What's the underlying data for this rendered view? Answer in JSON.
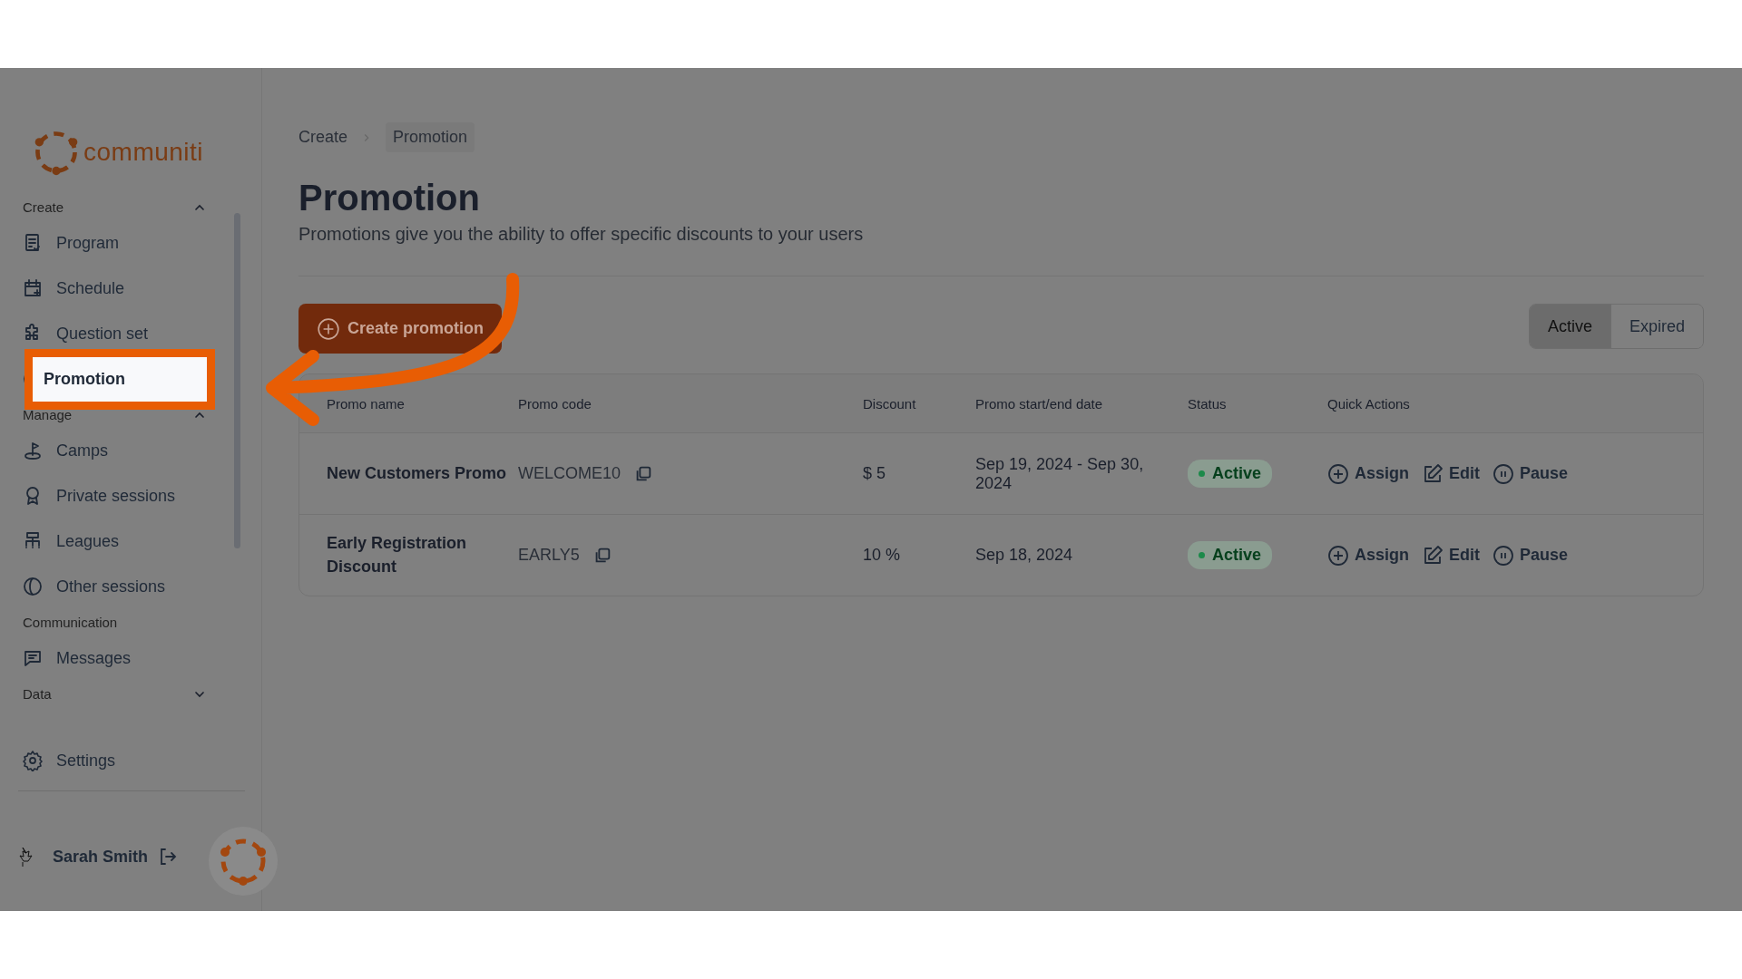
{
  "logo": {
    "text": "communiti"
  },
  "sidebar": {
    "sections": [
      {
        "title": "Create",
        "expanded": true,
        "items": [
          {
            "label": "Program",
            "selected": false
          },
          {
            "label": "Schedule",
            "selected": false
          },
          {
            "label": "Question set",
            "selected": false
          },
          {
            "label": "Promotion",
            "selected": true
          }
        ]
      },
      {
        "title": "Manage",
        "expanded": true,
        "items": [
          {
            "label": "Camps",
            "selected": false
          },
          {
            "label": "Private sessions",
            "selected": false
          },
          {
            "label": "Leagues",
            "selected": false
          },
          {
            "label": "Other sessions",
            "selected": false
          }
        ]
      },
      {
        "title": "Communication",
        "items": [
          {
            "label": "Messages",
            "selected": false
          }
        ]
      },
      {
        "title": "Data",
        "expanded": false
      }
    ],
    "settings": {
      "label": "Settings"
    },
    "user": {
      "name": "Sarah Smith"
    }
  },
  "breadcrumb": [
    {
      "label": "Create",
      "current": false
    },
    {
      "label": "Promotion",
      "current": true
    }
  ],
  "page": {
    "title": "Promotion",
    "subtitle": "Promotions give you the ability to offer specific discounts to your users"
  },
  "create_button": {
    "label": "Create promotion"
  },
  "filter_tabs": [
    {
      "label": "Active",
      "selected": true
    },
    {
      "label": "Expired",
      "selected": false
    }
  ],
  "table": {
    "columns": [
      "Promo name",
      "Promo code",
      "Discount",
      "Promo start/end date",
      "Status",
      "Quick Actions"
    ],
    "rows": [
      {
        "name": "New Customers Promo",
        "code": "WELCOME10",
        "discount": "$ 5",
        "dates": "Sep 19, 2024 - Sep 30, 2024",
        "status": {
          "label": "Active",
          "color": "#1c8a4a"
        },
        "actions": [
          "Assign",
          "Edit",
          "Pause"
        ]
      },
      {
        "name": "Early Registration Discount",
        "code": "EARLY5",
        "discount": "10 %",
        "dates": "Sep 18, 2024",
        "status": {
          "label": "Active",
          "color": "#1c8a4a"
        },
        "actions": [
          "Assign",
          "Edit",
          "Pause"
        ]
      }
    ]
  }
}
